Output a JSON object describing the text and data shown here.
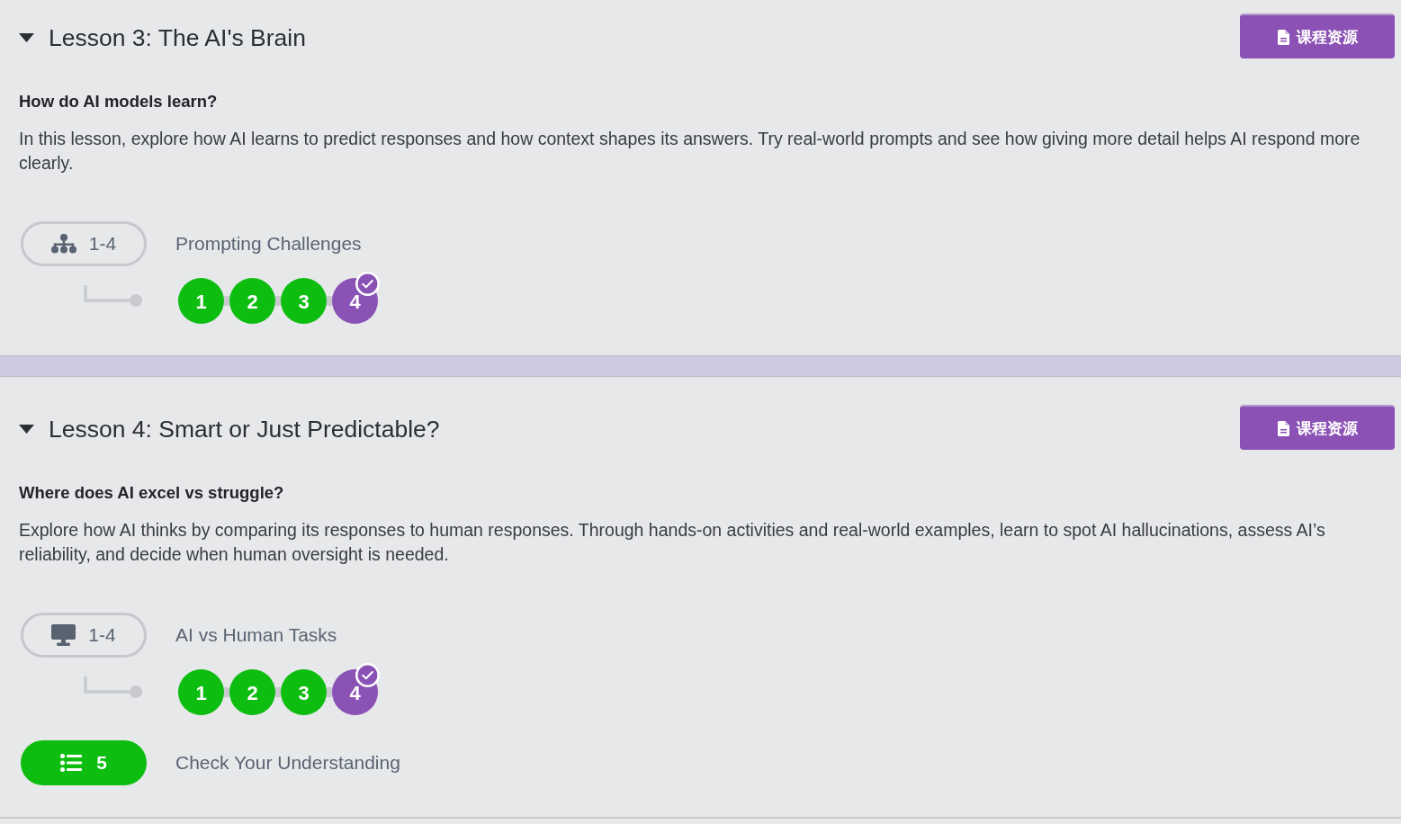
{
  "lessons": [
    {
      "title": "Lesson 3: The AI's Brain",
      "expanded": true,
      "resource_button": "课程资源",
      "question": "How do AI models learn?",
      "description": "In this lesson, explore how AI learns to predict responses and how context shapes its answers. Try real-world prompts and see how giving more detail helps AI respond more clearly.",
      "activities": [
        {
          "kind": "network",
          "pill_label": "1-4",
          "title": "Prompting Challenges",
          "levels": [
            {
              "label": "1",
              "color": "#0dbd10",
              "checked": false
            },
            {
              "label": "2",
              "color": "#0dbd10",
              "checked": false
            },
            {
              "label": "3",
              "color": "#0dbd10",
              "checked": false
            },
            {
              "label": "4",
              "color": "#8b52b6",
              "checked": true
            }
          ]
        }
      ]
    },
    {
      "title": "Lesson 4: Smart or Just Predictable?",
      "expanded": true,
      "resource_button": "课程资源",
      "question": "Where does AI excel vs struggle?",
      "description": "Explore how AI thinks by comparing its responses to human responses. Through hands-on activities and real-world examples, learn to spot AI hallucinations, assess AI’s reliability, and decide when human oversight is needed.",
      "activities": [
        {
          "kind": "computer",
          "pill_label": "1-4",
          "title": "AI vs Human Tasks",
          "levels": [
            {
              "label": "1",
              "color": "#0dbd10",
              "checked": false
            },
            {
              "label": "2",
              "color": "#0dbd10",
              "checked": false
            },
            {
              "label": "3",
              "color": "#0dbd10",
              "checked": false
            },
            {
              "label": "4",
              "color": "#8b52b6",
              "checked": true
            }
          ]
        },
        {
          "kind": "list",
          "pill_label": "5",
          "title": "Check Your Understanding"
        }
      ]
    }
  ]
}
